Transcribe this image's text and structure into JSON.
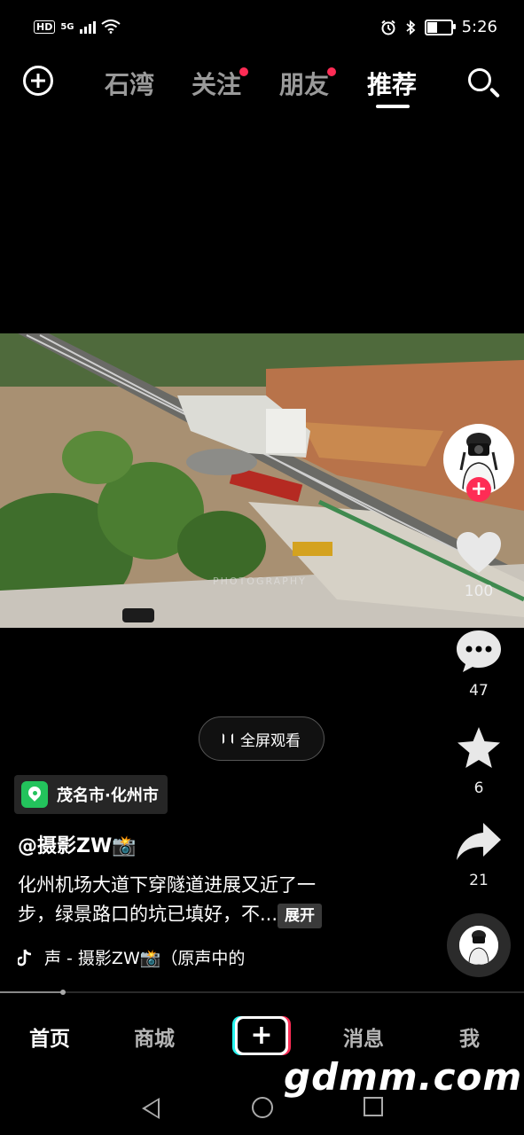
{
  "status_bar": {
    "hd": "HD",
    "network": "5G",
    "time": "5:26",
    "battery_level": 0.45
  },
  "top_nav": {
    "tabs": [
      {
        "label": "石湾",
        "active": false,
        "dot": false
      },
      {
        "label": "关注",
        "active": false,
        "dot": true
      },
      {
        "label": "朋友",
        "active": false,
        "dot": true
      },
      {
        "label": "推荐",
        "active": true,
        "dot": false
      }
    ]
  },
  "video": {
    "watermark_text": "PHOTOGRAPHY"
  },
  "rail": {
    "likes": "100",
    "comments": "47",
    "favorites": "6",
    "shares": "21",
    "follow_symbol": "+"
  },
  "fullscreen_label": "全屏观看",
  "location": "茂名市·化州市",
  "author": "@摄影ZW📸",
  "caption": {
    "line1": "化州机场大道下穿隧道进展又近了一",
    "line2": "步，绿景路口的坑已填好，不...",
    "expand": "展开"
  },
  "music": "声 - 摄影ZW📸（原声中的",
  "playback_progress": 0.12,
  "bottom_nav": {
    "items": [
      "首页",
      "商城",
      "消息",
      "我"
    ],
    "create_symbol": "+"
  },
  "overlay_watermark": "gdmm.com",
  "colors": {
    "accent_red": "#fe2c55",
    "accent_cyan": "#25f4ee",
    "location_green": "#23c35c"
  }
}
